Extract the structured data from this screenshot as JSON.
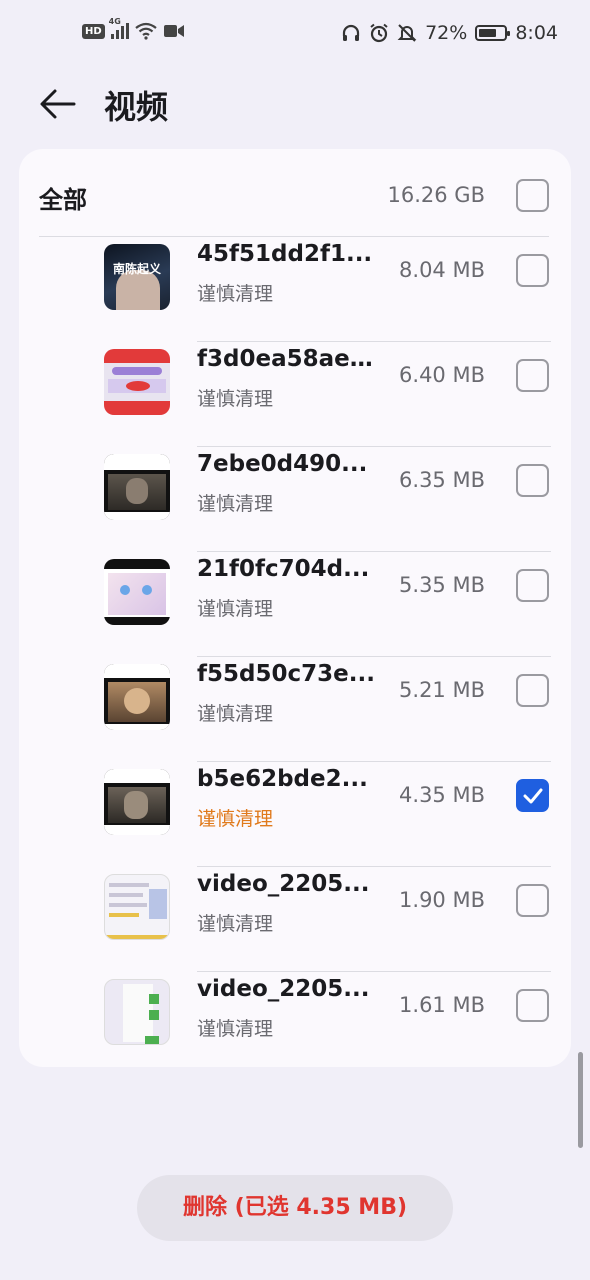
{
  "status_bar": {
    "hd": "HD",
    "network": "4G",
    "battery_percent": "72%",
    "battery_level": 0.72,
    "time": "8:04",
    "icons": [
      "hd-icon",
      "signal-icon",
      "wifi-icon",
      "video-camera-icon",
      "headphones-icon",
      "alarm-icon",
      "bell-off-icon",
      "battery-icon"
    ]
  },
  "header": {
    "back_icon": "arrow-left-icon",
    "title": "视频"
  },
  "list": {
    "all_label": "全部",
    "all_size": "16.26 GB",
    "all_checked": false,
    "items": [
      {
        "name": "45f51dd2f1...",
        "tag": "谨慎清理",
        "size": "8.04 MB",
        "checked": false
      },
      {
        "name": "f3d0ea58ae...",
        "tag": "谨慎清理",
        "size": "6.40 MB",
        "checked": false
      },
      {
        "name": "7ebe0d490...",
        "tag": "谨慎清理",
        "size": "6.35 MB",
        "checked": false
      },
      {
        "name": "21f0fc704d...",
        "tag": "谨慎清理",
        "size": "5.35 MB",
        "checked": false
      },
      {
        "name": "f55d50c73e...",
        "tag": "谨慎清理",
        "size": "5.21 MB",
        "checked": false
      },
      {
        "name": "b5e62bde2...",
        "tag": "谨慎清理",
        "size": "4.35 MB",
        "checked": true
      },
      {
        "name": "video_2205...",
        "tag": "谨慎清理",
        "size": "1.90 MB",
        "checked": false
      },
      {
        "name": "video_2205...",
        "tag": "谨慎清理",
        "size": "1.61 MB",
        "checked": false
      }
    ],
    "thumb_text_0": "南陈起义"
  },
  "footer": {
    "delete_label": "删除 (已选 4.35 MB)"
  },
  "colors": {
    "accent": "#1f5fe0",
    "warning_tag": "#e07a1c",
    "delete_text": "#e0352f",
    "background": "#f1eff8",
    "card": "#fbf9fd"
  }
}
